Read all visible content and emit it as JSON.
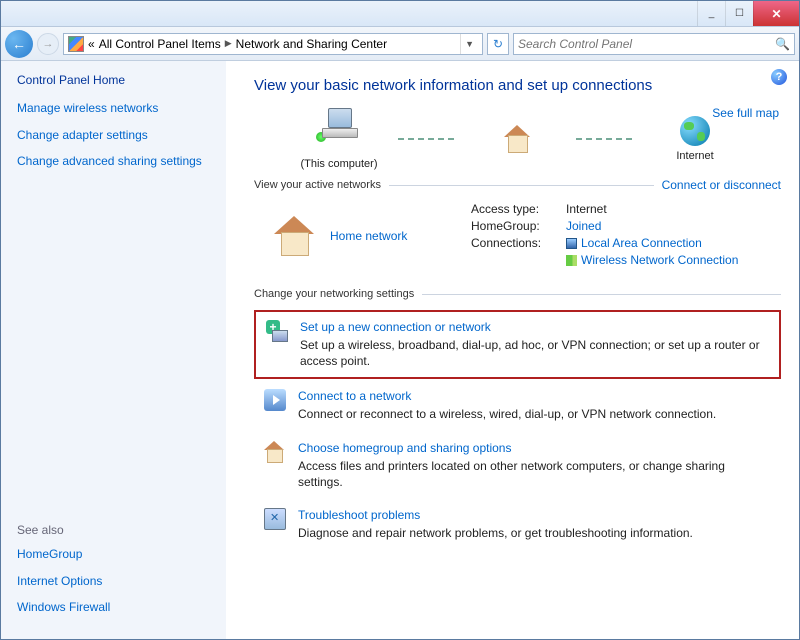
{
  "titlebar": {
    "min": "_",
    "max": "☐",
    "close": "✕"
  },
  "nav": {
    "back_glyph": "←",
    "fwd_glyph": "→",
    "breadcrumb_prefix": "«",
    "breadcrumb1": "All Control Panel Items",
    "breadcrumb2": "Network and Sharing Center",
    "refresh": "↻",
    "search_placeholder": "Search Control Panel",
    "search_glyph": "🔍"
  },
  "sidebar": {
    "title": "Control Panel Home",
    "links": [
      "Manage wireless networks",
      "Change adapter settings",
      "Change advanced sharing settings"
    ],
    "see_also_hdr": "See also",
    "see_also": [
      "HomeGroup",
      "Internet Options",
      "Windows Firewall"
    ]
  },
  "main": {
    "help": "?",
    "heading": "View your basic network information and set up connections",
    "full_map": "See full map",
    "node_this": "(This computer)",
    "node_internet": "Internet",
    "active_hdr": "View your active networks",
    "connect_toggle": "Connect or disconnect",
    "home_network": "Home network",
    "info": {
      "access_k": "Access type:",
      "access_v": "Internet",
      "homegroup_k": "HomeGroup:",
      "homegroup_v": "Joined",
      "conn_k": "Connections:",
      "conn1": "Local Area Connection",
      "conn2": "Wireless Network Connection"
    },
    "change_hdr": "Change your networking settings",
    "items": [
      {
        "title": "Set up a new connection or network",
        "desc": "Set up a wireless, broadband, dial-up, ad hoc, or VPN connection; or set up a router or access point."
      },
      {
        "title": "Connect to a network",
        "desc": "Connect or reconnect to a wireless, wired, dial-up, or VPN network connection."
      },
      {
        "title": "Choose homegroup and sharing options",
        "desc": "Access files and printers located on other network computers, or change sharing settings."
      },
      {
        "title": "Troubleshoot problems",
        "desc": "Diagnose and repair network problems, or get troubleshooting information."
      }
    ]
  }
}
